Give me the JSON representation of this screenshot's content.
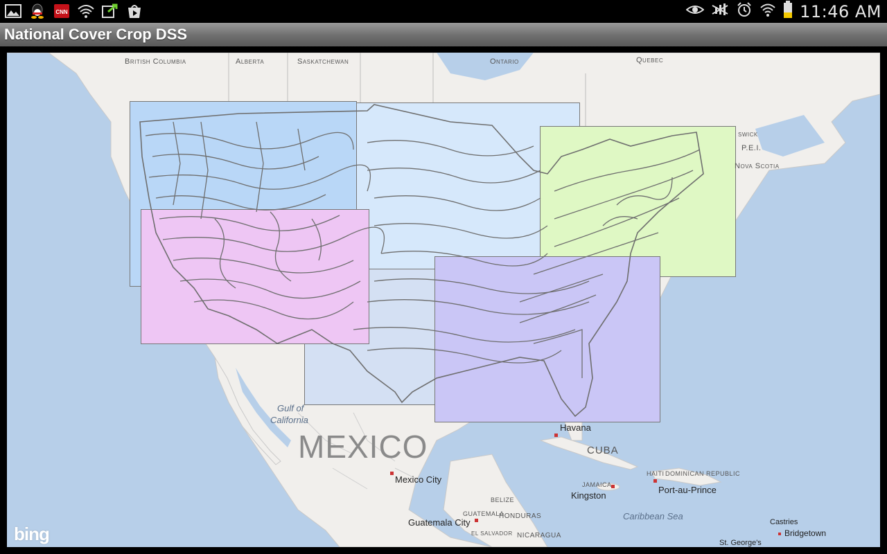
{
  "status_bar": {
    "time": "11:46 AM",
    "left_icons": [
      "gallery-icon",
      "qq-icon",
      "cnn-icon",
      "wifi-question-icon",
      "transfer-icon",
      "play-store-icon"
    ],
    "right_icons": [
      "eye-icon",
      "signal-mute-icon",
      "alarm-icon",
      "wifi-icon",
      "battery-icon"
    ],
    "cnn_label": "CNN"
  },
  "app": {
    "title": "National Cover Crop DSS"
  },
  "map": {
    "provider_logo": "bing",
    "labels": {
      "british_columbia": "British Columbia",
      "alberta": "Alberta",
      "saskatchewan": "Saskatchewan",
      "ontario": "Ontario",
      "quebec": "Quebec",
      "brunswick": "swick",
      "pei": "P.E.I.",
      "nova_scotia": "Nova Scotia",
      "gulf_of": "Gulf of",
      "california": "California",
      "mexico": "MEXICO",
      "mexico_city": "Mexico City",
      "havana": "Havana",
      "cuba": "CUBA",
      "jamaica": "JAMAICA",
      "kingston": "Kingston",
      "haiti": "HAITI",
      "dominican_republic": "DOMINICAN REPUBLIC",
      "port_au_prince": "Port-au-Prince",
      "caribbean_sea": "Caribbean Sea",
      "belize": "BELIZE",
      "guatemala": "GUATEMALA",
      "honduras": "HONDURAS",
      "guatemala_city": "Guatemala City",
      "el_salvador": "EL SALVADOR",
      "nicaragua": "NICARAGUA",
      "castries": "Castries",
      "bridgetown": "Bridgetown",
      "st_georges": "St. George's"
    },
    "regions": [
      {
        "name": "northwest",
        "color": "#b9d7f7"
      },
      {
        "name": "north-central",
        "color": "#d6e8fb"
      },
      {
        "name": "northeast",
        "color": "#dff8c4"
      },
      {
        "name": "southwest",
        "color": "#eec6f4"
      },
      {
        "name": "south-central",
        "color": "#d4e0f3"
      },
      {
        "name": "southeast",
        "color": "#cac6f6"
      }
    ]
  },
  "colors": {
    "title_text": "#ffffff",
    "water": "#b7cfe9",
    "land": "#f1efec",
    "contour": "#6e6e6e"
  }
}
